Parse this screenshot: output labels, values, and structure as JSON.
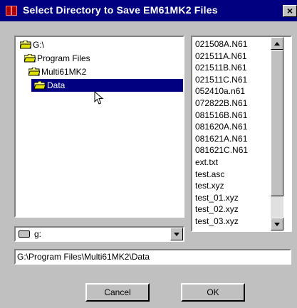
{
  "window": {
    "title": "Select Directory to Save EM61MK2 Files",
    "close_label": "×"
  },
  "directory_tree": {
    "items": [
      {
        "label": "G:\\",
        "selected": false
      },
      {
        "label": "Program Files",
        "selected": false
      },
      {
        "label": "Multi61MK2",
        "selected": false
      },
      {
        "label": "Data",
        "selected": true
      }
    ]
  },
  "file_list": {
    "items": [
      "021508A.N61",
      "021511A.N61",
      "021511B.N61",
      "021511C.N61",
      "052410a.n61",
      "072822B.N61",
      "081516B.N61",
      "081620A.N61",
      "081621A.N61",
      "081621C.N61",
      "ext.txt",
      "test.asc",
      "test.xyz",
      "test_01.xyz",
      "test_02.xyz",
      "test_03.xyz"
    ]
  },
  "drive": {
    "selected": "g:"
  },
  "path": {
    "value": "G:\\Program Files\\Multi61MK2\\Data"
  },
  "buttons": {
    "cancel": "Cancel",
    "ok": "OK"
  },
  "colors": {
    "titlebar": "#000080",
    "selection": "#000080",
    "face": "#c0c0c0",
    "folder": "#ffff80"
  },
  "icons": {
    "folder": "folder-icon",
    "open_folder": "folder-open-icon",
    "drive": "drive-icon",
    "cursor": "mouse-cursor-icon"
  }
}
